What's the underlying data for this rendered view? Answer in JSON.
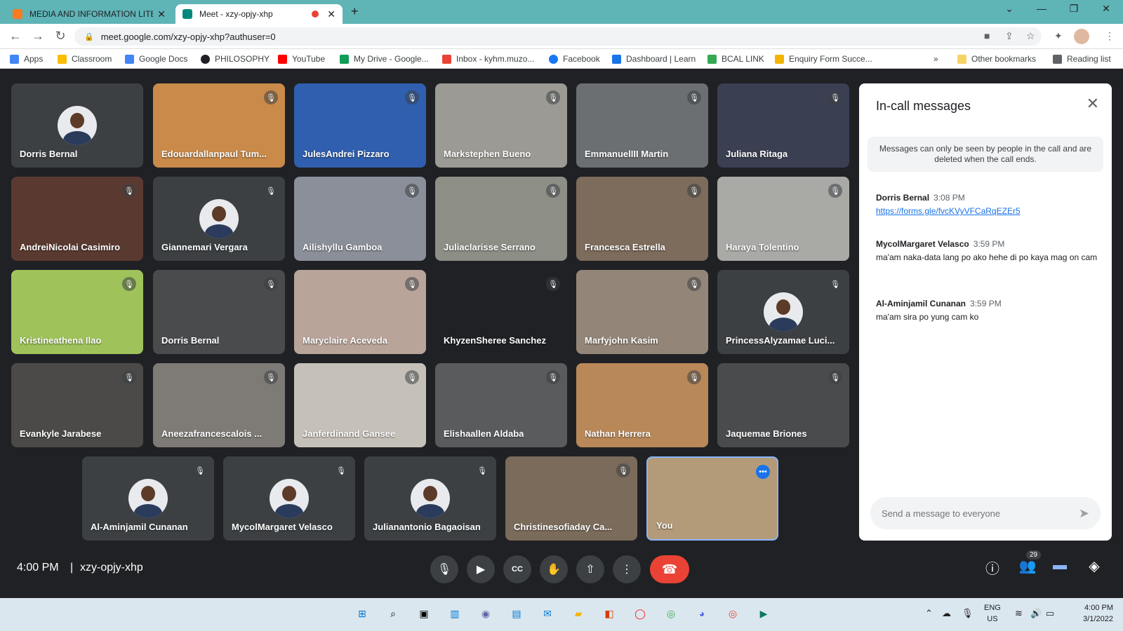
{
  "browser": {
    "tabs": [
      {
        "title": "MEDIA AND INFORMATION LITER",
        "favicon_color": "#f97a1f"
      },
      {
        "title": "Meet - xzy-opjy-xhp",
        "favicon_color": "#00897b",
        "recording": true
      }
    ],
    "new_tab": "+",
    "url": "meet.google.com/xzy-opjy-xhp?authuser=0",
    "bookmarks": [
      {
        "label": "Apps",
        "color": "#4285f4"
      },
      {
        "label": "Classroom",
        "color": "#fbbc04"
      },
      {
        "label": "Google Docs",
        "color": "#4285f4"
      },
      {
        "label": "PHILOSOPHY",
        "color": "#202124"
      },
      {
        "label": "YouTube",
        "color": "#ff0000"
      },
      {
        "label": "My Drive - Google...",
        "color": "#0f9d58"
      },
      {
        "label": "Inbox - kyhm.muzo...",
        "color": "#ea4335"
      },
      {
        "label": "Facebook",
        "color": "#1877f2"
      },
      {
        "label": "Dashboard | Learn",
        "color": "#1a73e8"
      },
      {
        "label": "BCAL LINK",
        "color": "#34a853"
      },
      {
        "label": "Enquiry Form Succe...",
        "color": "#f4b400"
      }
    ],
    "more_bookmarks": "»",
    "other_bookmarks": "Other bookmarks",
    "reading_list": "Reading list"
  },
  "participants": [
    {
      "name": "Dorris Bernal",
      "avatar": true,
      "bg": "#3c4043"
    },
    {
      "name": "Edouardallanpaul Tum...",
      "bg": "#c98a4a"
    },
    {
      "name": "JulesAndrei Pizzaro",
      "bg": "#2f5fae"
    },
    {
      "name": "Markstephen Bueno",
      "bg": "#9c9a94"
    },
    {
      "name": "EmmanuelIII Martin",
      "bg": "#6b6f72"
    },
    {
      "name": "Juliana Ritaga",
      "bg": "#3a3f52"
    },
    {
      "name": "AndreiNicolai Casimiro",
      "bg": "#5a3a30"
    },
    {
      "name": "Giannemari Vergara",
      "avatar": true,
      "bg": "#3c4043"
    },
    {
      "name": "Ailishyllu Gamboa",
      "bg": "#8a8f9a"
    },
    {
      "name": "Juliaclarisse Serrano",
      "bg": "#8d8e86"
    },
    {
      "name": "Francesca Estrella",
      "bg": "#7d6b5c"
    },
    {
      "name": "Haraya Tolentino",
      "bg": "#a9a9a6"
    },
    {
      "name": "Kristineathena Ilao",
      "bg": "#9fc35a"
    },
    {
      "name": "Dorris Bernal",
      "bg": "#4a4b4d"
    },
    {
      "name": "Maryclaire Aceveda",
      "bg": "#b9a49a"
    },
    {
      "name": "KhyzenSheree Sanchez",
      "bg": "#202124"
    },
    {
      "name": "Marfyjohn Kasim",
      "bg": "#938678"
    },
    {
      "name": "PrincessAlyzamae Luci...",
      "avatar": true,
      "bg": "#3c4043"
    },
    {
      "name": "Evankyle Jarabese",
      "bg": "#4b4a48"
    },
    {
      "name": "Aneezafrancescalois ...",
      "bg": "#7e7a76"
    },
    {
      "name": "Janferdinand Gansee",
      "bg": "#c6c1b8"
    },
    {
      "name": "Elishaallen Aldaba",
      "bg": "#5a5b5d"
    },
    {
      "name": "Nathan Herrera",
      "bg": "#b98859"
    },
    {
      "name": "Jaquemae Briones",
      "bg": "#4a4b4d"
    },
    {
      "name": "Al-Aminjamil Cunanan",
      "avatar": true,
      "bg": "#3c4043"
    },
    {
      "name": "MycolMargaret Velasco",
      "avatar": true,
      "bg": "#3c4043"
    },
    {
      "name": "Julianantonio Bagaoisan",
      "avatar": true,
      "bg": "#3c4043"
    },
    {
      "name": "Christinesofiaday Ca...",
      "bg": "#7a6b5a"
    },
    {
      "name": "You",
      "bg": "#b39b7a",
      "self": true
    }
  ],
  "chat": {
    "title": "In-call messages",
    "notice": "Messages can only be seen by people in the call and are deleted when the call ends.",
    "messages": [
      {
        "sender": "Dorris Bernal",
        "time": "3:08 PM",
        "text": "https://forms.gle/fvcKVyVFCaRqEZEr5",
        "link": true
      },
      {
        "sender": "MycolMargaret Velasco",
        "time": "3:59 PM",
        "text": "ma'am naka-data lang po ako hehe di po kaya mag on cam"
      },
      {
        "sender": "Al-Aminjamil Cunanan",
        "time": "3:59 PM",
        "text": "ma'am sira po yung cam ko"
      }
    ],
    "input_placeholder": "Send a message to everyone"
  },
  "meeting": {
    "time": "4:00 PM",
    "separator": "|",
    "code": "xzy-opjy-xhp",
    "participant_count": "29"
  },
  "taskbar": {
    "lang": "ENG",
    "region": "US",
    "time": "4:00 PM",
    "date": "3/1/2022"
  }
}
